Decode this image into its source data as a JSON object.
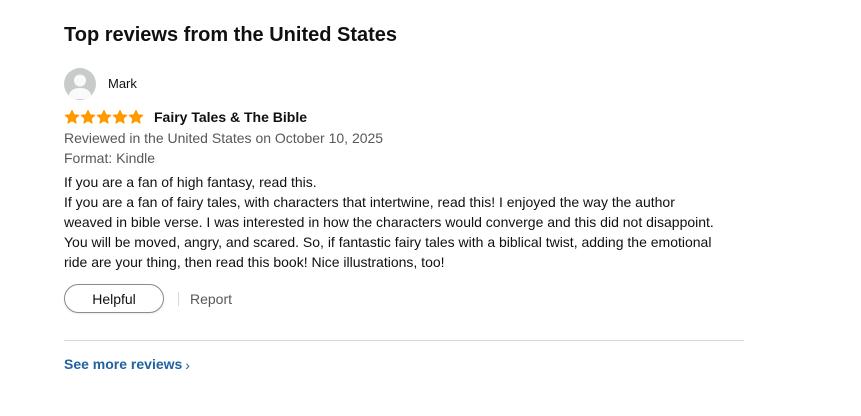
{
  "section": {
    "title": "Top reviews from the United States"
  },
  "review": {
    "profile_name": "Mark",
    "rating": 5,
    "rating_max": 5,
    "star_color": "#ff9900",
    "title": "Fairy Tales & The Bible",
    "date_line": "Reviewed in the United States on October 10, 2025",
    "format_line": "Format: Kindle",
    "body_lines": [
      "If you are a fan of high fantasy, read this.",
      "If you are a fan of fairy tales, with characters that intertwine, read this! I enjoyed the way the author",
      "weaved in bible verse. I was interested in how the characters would converge and this did not disappoint.",
      "You will be moved, angry, and scared. So, if fantastic fairy tales with a biblical twist, adding the emotional",
      "ride are your thing, then read this book! Nice illustrations, too!"
    ],
    "helpful_label": "Helpful",
    "report_label": "Report"
  },
  "footer": {
    "see_more_label": "See more reviews",
    "chevron": "›"
  },
  "colors": {
    "link": "#2162a1",
    "muted_text": "#565959",
    "avatar_bg": "#c7cbcc"
  }
}
